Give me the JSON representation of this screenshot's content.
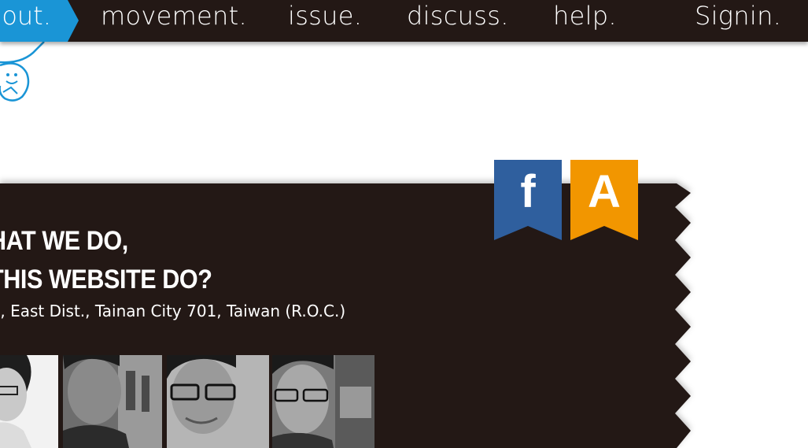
{
  "nav": {
    "active_label": "bout.",
    "items": [
      {
        "label": "movement."
      },
      {
        "label": "issue."
      },
      {
        "label": "discuss."
      },
      {
        "label": "help."
      },
      {
        "label": "Signin."
      }
    ]
  },
  "panel": {
    "headline_line1": "HAT WE DO,",
    "headline_line2": " THIS WEBSITE DO?",
    "address": "., East Dist., Tainan City 701, Taiwan (R.O.C.)"
  },
  "social": {
    "facebook_letter": "f",
    "facebook_color": "#2f5f9e",
    "a_letter": "A",
    "a_color": "#f29600"
  },
  "colors": {
    "nav_bg": "#231815",
    "active_tab": "#1a95d6",
    "mascot_stroke": "#1a95d6"
  },
  "team_photos": [
    "member-1",
    "member-2",
    "member-3",
    "member-4"
  ]
}
